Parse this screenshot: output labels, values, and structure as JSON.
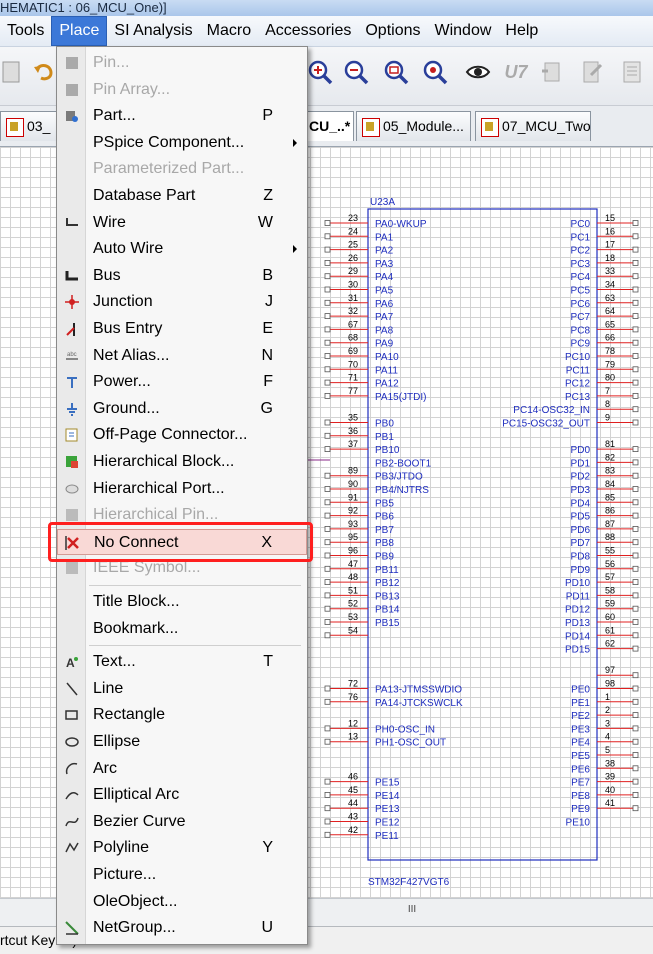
{
  "window": {
    "title": "HEMATIC1 : 06_MCU_One)]"
  },
  "menubar": [
    {
      "label": "Tools",
      "active": false
    },
    {
      "label": "Place",
      "active": true
    },
    {
      "label": "SI Analysis",
      "active": false
    },
    {
      "label": "Macro",
      "active": false
    },
    {
      "label": "Accessories",
      "active": false
    },
    {
      "label": "Options",
      "active": false
    },
    {
      "label": "Window",
      "active": false
    },
    {
      "label": "Help",
      "active": false
    }
  ],
  "toolbar": {
    "icons": [
      "new-icon",
      "undo-icon",
      "zoom-in-icon",
      "zoom-out-icon",
      "zoom-area-icon",
      "zoom-all-icon",
      "eye-icon",
      "u7-icon",
      "update-part-icon",
      "edit-part-icon",
      "document-icon"
    ],
    "u7_label": "U7"
  },
  "tabs": [
    {
      "label": "03_",
      "active": false
    },
    {
      "label": "CU_..*",
      "active": true
    },
    {
      "label": "05_Module...",
      "active": false
    },
    {
      "label": "07_MCU_Two",
      "active": false
    }
  ],
  "place_menu": [
    {
      "label": "Pin...",
      "shortcut": "",
      "enabled": false,
      "submenu": false,
      "icon": "pin-icon"
    },
    {
      "label": "Pin Array...",
      "shortcut": "",
      "enabled": false,
      "submenu": false,
      "icon": "pin-array-icon"
    },
    {
      "label": "Part...",
      "shortcut": "P",
      "enabled": true,
      "submenu": false,
      "icon": "part-icon"
    },
    {
      "label": "PSpice Component...",
      "shortcut": "",
      "enabled": true,
      "submenu": true,
      "icon": ""
    },
    {
      "label": "Parameterized Part...",
      "shortcut": "",
      "enabled": false,
      "submenu": false,
      "icon": ""
    },
    {
      "label": "Database Part",
      "shortcut": "Z",
      "enabled": true,
      "submenu": false,
      "icon": ""
    },
    {
      "label": "Wire",
      "shortcut": "W",
      "enabled": true,
      "submenu": false,
      "icon": "wire-icon"
    },
    {
      "label": "Auto Wire",
      "shortcut": "",
      "enabled": true,
      "submenu": true,
      "icon": ""
    },
    {
      "label": "Bus",
      "shortcut": "B",
      "enabled": true,
      "submenu": false,
      "icon": "bus-icon"
    },
    {
      "label": "Junction",
      "shortcut": "J",
      "enabled": true,
      "submenu": false,
      "icon": "junction-icon"
    },
    {
      "label": "Bus Entry",
      "shortcut": "E",
      "enabled": true,
      "submenu": false,
      "icon": "bus-entry-icon"
    },
    {
      "label": "Net Alias...",
      "shortcut": "N",
      "enabled": true,
      "submenu": false,
      "icon": "net-alias-icon"
    },
    {
      "label": "Power...",
      "shortcut": "F",
      "enabled": true,
      "submenu": false,
      "icon": "power-icon"
    },
    {
      "label": "Ground...",
      "shortcut": "G",
      "enabled": true,
      "submenu": false,
      "icon": "ground-icon"
    },
    {
      "label": "Off-Page Connector...",
      "shortcut": "",
      "enabled": true,
      "submenu": false,
      "icon": "off-page-connector-icon"
    },
    {
      "label": "Hierarchical Block...",
      "shortcut": "",
      "enabled": true,
      "submenu": false,
      "icon": "hierarchical-block-icon"
    },
    {
      "label": "Hierarchical Port...",
      "shortcut": "",
      "enabled": true,
      "submenu": false,
      "icon": "hierarchical-port-icon"
    },
    {
      "label": "Hierarchical Pin...",
      "shortcut": "",
      "enabled": false,
      "submenu": false,
      "icon": "hierarchical-pin-icon"
    },
    {
      "label": "No Connect",
      "shortcut": "X",
      "enabled": true,
      "submenu": false,
      "icon": "no-connect-icon",
      "highlighted": true
    },
    {
      "label": "IEEE Symbol...",
      "shortcut": "",
      "enabled": false,
      "submenu": false,
      "icon": "ieee-symbol-icon"
    },
    {
      "separator": true
    },
    {
      "label": "Title Block...",
      "shortcut": "",
      "enabled": true,
      "submenu": false,
      "icon": ""
    },
    {
      "label": "Bookmark...",
      "shortcut": "",
      "enabled": true,
      "submenu": false,
      "icon": ""
    },
    {
      "separator": true
    },
    {
      "label": "Text...",
      "shortcut": "T",
      "enabled": true,
      "submenu": false,
      "icon": "text-icon"
    },
    {
      "label": "Line",
      "shortcut": "",
      "enabled": true,
      "submenu": false,
      "icon": "line-icon"
    },
    {
      "label": "Rectangle",
      "shortcut": "",
      "enabled": true,
      "submenu": false,
      "icon": "rectangle-icon"
    },
    {
      "label": "Ellipse",
      "shortcut": "",
      "enabled": true,
      "submenu": false,
      "icon": "ellipse-icon"
    },
    {
      "label": "Arc",
      "shortcut": "",
      "enabled": true,
      "submenu": false,
      "icon": "arc-icon"
    },
    {
      "label": "Elliptical Arc",
      "shortcut": "",
      "enabled": true,
      "submenu": false,
      "icon": "elliptical-arc-icon"
    },
    {
      "label": "Bezier Curve",
      "shortcut": "",
      "enabled": true,
      "submenu": false,
      "icon": "bezier-curve-icon"
    },
    {
      "label": "Polyline",
      "shortcut": "Y",
      "enabled": true,
      "submenu": false,
      "icon": "polyline-icon"
    },
    {
      "label": "Picture...",
      "shortcut": "",
      "enabled": true,
      "submenu": false,
      "icon": ""
    },
    {
      "label": "OleObject...",
      "shortcut": "",
      "enabled": true,
      "submenu": false,
      "icon": ""
    },
    {
      "label": "NetGroup...",
      "shortcut": "U",
      "enabled": true,
      "submenu": false,
      "icon": "netgroup-icon"
    }
  ],
  "schematic": {
    "ref": "U23A",
    "part_name": "STM32F427VGT6",
    "left_pins": [
      {
        "num": "23",
        "name": "PA0-WKUP"
      },
      {
        "num": "24",
        "name": "PA1"
      },
      {
        "num": "25",
        "name": "PA2"
      },
      {
        "num": "26",
        "name": "PA3"
      },
      {
        "num": "29",
        "name": "PA4"
      },
      {
        "num": "30",
        "name": "PA5"
      },
      {
        "num": "31",
        "name": "PA6"
      },
      {
        "num": "32",
        "name": "PA7"
      },
      {
        "num": "67",
        "name": "PA8"
      },
      {
        "num": "68",
        "name": "PA9"
      },
      {
        "num": "69",
        "name": "PA10"
      },
      {
        "num": "70",
        "name": "PA11"
      },
      {
        "num": "71",
        "name": "PA12"
      },
      {
        "num": "77",
        "name": "PA15(JTDI)"
      },
      {
        "num": "",
        "name": ""
      },
      {
        "num": "35",
        "name": "PB0"
      },
      {
        "num": "36",
        "name": "PB1"
      },
      {
        "num": "37",
        "name": "PB10"
      },
      {
        "num": "",
        "name": "PB2-BOOT1"
      },
      {
        "num": "89",
        "name": "PB3/JTDO"
      },
      {
        "num": "90",
        "name": "PB4/NJTRS"
      },
      {
        "num": "91",
        "name": "PB5"
      },
      {
        "num": "92",
        "name": "PB6"
      },
      {
        "num": "93",
        "name": "PB7"
      },
      {
        "num": "95",
        "name": "PB8"
      },
      {
        "num": "96",
        "name": "PB9"
      },
      {
        "num": "47",
        "name": "PB11"
      },
      {
        "num": "48",
        "name": "PB12"
      },
      {
        "num": "51",
        "name": "PB13"
      },
      {
        "num": "52",
        "name": "PB14"
      },
      {
        "num": "53",
        "name": "PB15"
      },
      {
        "num": "54",
        "name": ""
      },
      {
        "num": "",
        "name": ""
      },
      {
        "num": "",
        "name": ""
      },
      {
        "num": "",
        "name": ""
      },
      {
        "num": "72",
        "name": "PA13-JTMSSWDIO"
      },
      {
        "num": "76",
        "name": "PA14-JTCKSWCLK"
      },
      {
        "num": "",
        "name": ""
      },
      {
        "num": "12",
        "name": "PH0-OSC_IN"
      },
      {
        "num": "13",
        "name": "PH1-OSC_OUT"
      },
      {
        "num": "",
        "name": ""
      },
      {
        "num": "",
        "name": ""
      },
      {
        "num": "46",
        "name": "PE15"
      },
      {
        "num": "45",
        "name": "PE14"
      },
      {
        "num": "44",
        "name": "PE13"
      },
      {
        "num": "43",
        "name": "PE12"
      },
      {
        "num": "42",
        "name": "PE11"
      }
    ],
    "right_pins": [
      {
        "num": "15",
        "name": "PC0"
      },
      {
        "num": "16",
        "name": "PC1"
      },
      {
        "num": "17",
        "name": "PC2"
      },
      {
        "num": "18",
        "name": "PC3"
      },
      {
        "num": "33",
        "name": "PC4"
      },
      {
        "num": "34",
        "name": "PC5"
      },
      {
        "num": "63",
        "name": "PC6"
      },
      {
        "num": "64",
        "name": "PC7"
      },
      {
        "num": "65",
        "name": "PC8"
      },
      {
        "num": "66",
        "name": "PC9"
      },
      {
        "num": "78",
        "name": "PC10"
      },
      {
        "num": "79",
        "name": "PC11"
      },
      {
        "num": "80",
        "name": "PC12"
      },
      {
        "num": "7",
        "name": "PC13"
      },
      {
        "num": "8",
        "name": "PC14-OSC32_IN"
      },
      {
        "num": "9",
        "name": "PC15-OSC32_OUT"
      },
      {
        "num": "",
        "name": ""
      },
      {
        "num": "81",
        "name": "PD0"
      },
      {
        "num": "82",
        "name": "PD1"
      },
      {
        "num": "83",
        "name": "PD2"
      },
      {
        "num": "84",
        "name": "PD3"
      },
      {
        "num": "85",
        "name": "PD4"
      },
      {
        "num": "86",
        "name": "PD5"
      },
      {
        "num": "87",
        "name": "PD6"
      },
      {
        "num": "88",
        "name": "PD7"
      },
      {
        "num": "55",
        "name": "PD8"
      },
      {
        "num": "56",
        "name": "PD9"
      },
      {
        "num": "57",
        "name": "PD10"
      },
      {
        "num": "58",
        "name": "PD11"
      },
      {
        "num": "59",
        "name": "PD12"
      },
      {
        "num": "60",
        "name": "PD13"
      },
      {
        "num": "61",
        "name": "PD14"
      },
      {
        "num": "62",
        "name": "PD15"
      },
      {
        "num": "",
        "name": ""
      },
      {
        "num": "97",
        "name": ""
      },
      {
        "num": "98",
        "name": "PE0"
      },
      {
        "num": "1",
        "name": "PE1"
      },
      {
        "num": "2",
        "name": "PE2"
      },
      {
        "num": "3",
        "name": "PE3"
      },
      {
        "num": "4",
        "name": "PE4"
      },
      {
        "num": "5",
        "name": "PE5"
      },
      {
        "num": "38",
        "name": "PE6"
      },
      {
        "num": "39",
        "name": "PE7"
      },
      {
        "num": "40",
        "name": "PE8"
      },
      {
        "num": "41",
        "name": "PE9"
      },
      {
        "num": "",
        "name": "PE10"
      }
    ],
    "scroll_grip": "III"
  },
  "statusbar": {
    "text": "rtcut Key: X)"
  },
  "colors": {
    "pin_line": "#e02020",
    "body_outline": "#1e2dbe",
    "pin_text": "#1e2dbe",
    "highlight_box": "#ff1f1f",
    "menu_active": "#3c78d8"
  }
}
